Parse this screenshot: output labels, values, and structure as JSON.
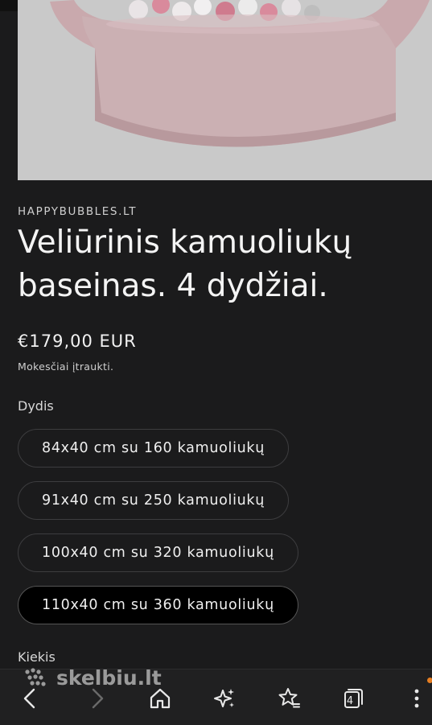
{
  "product": {
    "vendor": "HAPPYBUBBLES.LT",
    "title": "Veliūrinis kamuoliukų baseinas. 4 dydžiai.",
    "price": "€179,00 EUR",
    "tax_note": "Mokesčiai įtraukti."
  },
  "options": {
    "size_label": "Dydis",
    "variants": [
      {
        "label": "84x40 cm su 160 kamuoliukų",
        "selected": false
      },
      {
        "label": "91x40 cm su 250 kamuoliukų",
        "selected": false
      },
      {
        "label": "100x40 cm su 320 kamuoliukų",
        "selected": false
      },
      {
        "label": "110x40 cm su 360 kamuoliukų",
        "selected": true
      }
    ],
    "quantity_label": "Kiekis"
  },
  "watermark": {
    "text": "skelbiu.lt"
  },
  "browser_nav": {
    "tab_count": "4",
    "icons": [
      "back-icon",
      "forward-icon",
      "home-icon",
      "sparkle-icon",
      "bookmark-star-icon",
      "tabs-icon",
      "more-icon"
    ]
  },
  "colors": {
    "background": "#1b1b1c",
    "selected_variant": "#000000",
    "notification_dot": "#e67e22"
  }
}
